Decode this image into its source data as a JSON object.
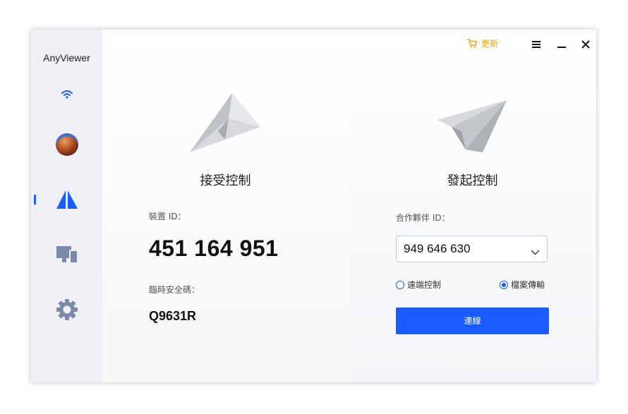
{
  "app": {
    "title": "AnyViewer"
  },
  "topbar": {
    "upgrade_label": "更新"
  },
  "receive": {
    "title": "接受控制",
    "device_id_label": "裝置 ID：",
    "device_id": "451 164 951",
    "temp_code_label": "臨時安全碼：",
    "temp_code": "Q9631R"
  },
  "initiate": {
    "title": "發起控制",
    "partner_id_label": "合作夥伴 ID：",
    "partner_id": "949 646 630",
    "options": [
      {
        "label": "遠端控制",
        "checked": false
      },
      {
        "label": "檔案傳輸",
        "checked": true
      }
    ],
    "connect_label": "連線"
  },
  "colors": {
    "accent": "#1a5cff",
    "upgrade": "#f0a020",
    "sidebar_bg": "#eef0f5",
    "nav_icon": "#7a8aa8"
  },
  "icons": {
    "wifi": "wifi-icon",
    "remote": "remote-control-icon",
    "screens": "devices-icon",
    "settings": "gear-icon",
    "cart": "cart-icon",
    "menu": "menu-icon",
    "minimize": "minimize-icon",
    "close": "close-icon"
  }
}
